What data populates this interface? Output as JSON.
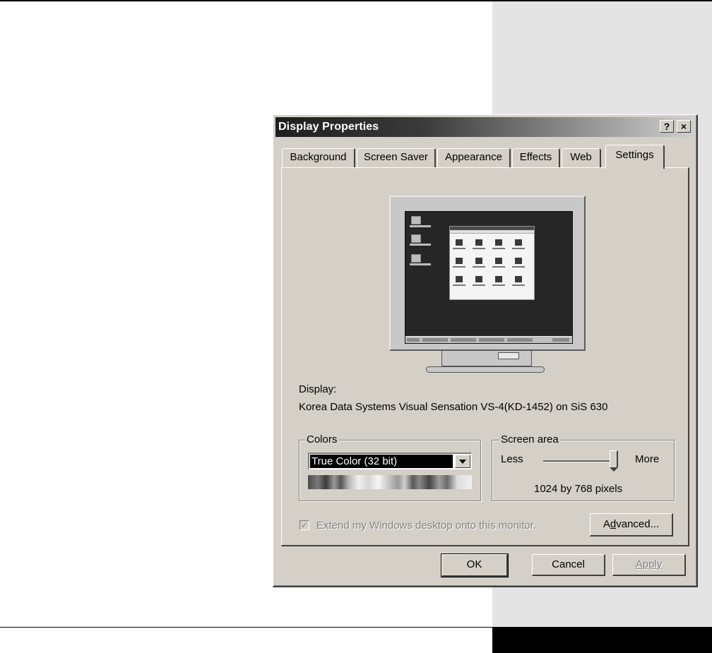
{
  "window": {
    "title": "Display Properties",
    "help_glyph": "?",
    "close_glyph": "×"
  },
  "tabs": [
    {
      "label": "Background"
    },
    {
      "label": "Screen Saver"
    },
    {
      "label": "Appearance"
    },
    {
      "label": "Effects"
    },
    {
      "label": "Web"
    },
    {
      "label": "Settings",
      "active": true
    }
  ],
  "display": {
    "label": "Display:",
    "value": "Korea Data Systems Visual Sensation VS-4(KD-1452) on SiS 630"
  },
  "colors": {
    "group_label": "Colors",
    "selected": "True Color (32 bit)"
  },
  "screen_area": {
    "group_label": "Screen area",
    "less_label": "Less",
    "more_label": "More",
    "resolution_text": "1024 by 768 pixels",
    "slider_level": 1.0
  },
  "extend_checkbox": {
    "label": "Extend my Windows desktop onto this monitor.",
    "checked": true,
    "enabled": false,
    "check_glyph": "✓"
  },
  "buttons": {
    "advanced_pre": "A",
    "advanced_key": "d",
    "advanced_post": "vanced...",
    "ok": "OK",
    "cancel": "Cancel",
    "apply": "Apply"
  },
  "icons": [
    "help-icon",
    "close-icon",
    "monitor-preview-icon",
    "dropdown-arrow-icon",
    "checkmark-icon"
  ]
}
